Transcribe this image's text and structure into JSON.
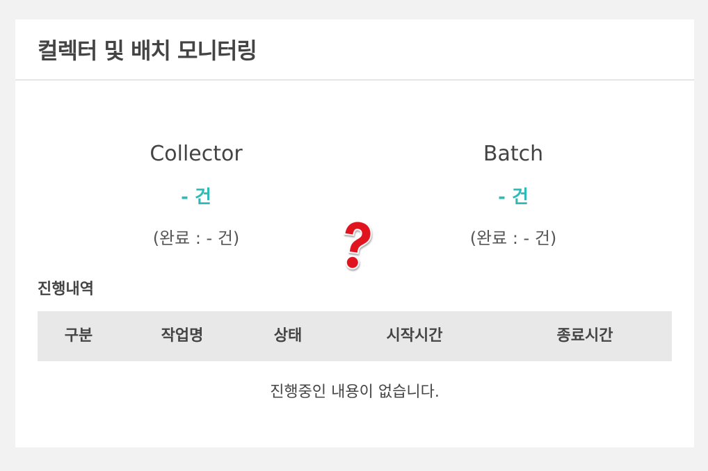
{
  "header": {
    "title": "컬렉터 및 배치 모니터링"
  },
  "stats": {
    "collector": {
      "name": "Collector",
      "count": "- 건",
      "completed": "(완료 : - 건)"
    },
    "batch": {
      "name": "Batch",
      "count": "- 건",
      "completed": "(완료 : - 건)"
    },
    "status_icon": "question-mark-icon"
  },
  "history": {
    "title": "진행내역",
    "columns": [
      "구분",
      "작업명",
      "상태",
      "시작시간",
      "종료시간"
    ],
    "rows": [],
    "empty_message": "진행중인 내용이 없습니다."
  },
  "colors": {
    "accent": "#2ebbb8",
    "question_mark": "#e0141e",
    "background": "#f2f2f2",
    "table_header_bg": "#e8e8e8"
  }
}
